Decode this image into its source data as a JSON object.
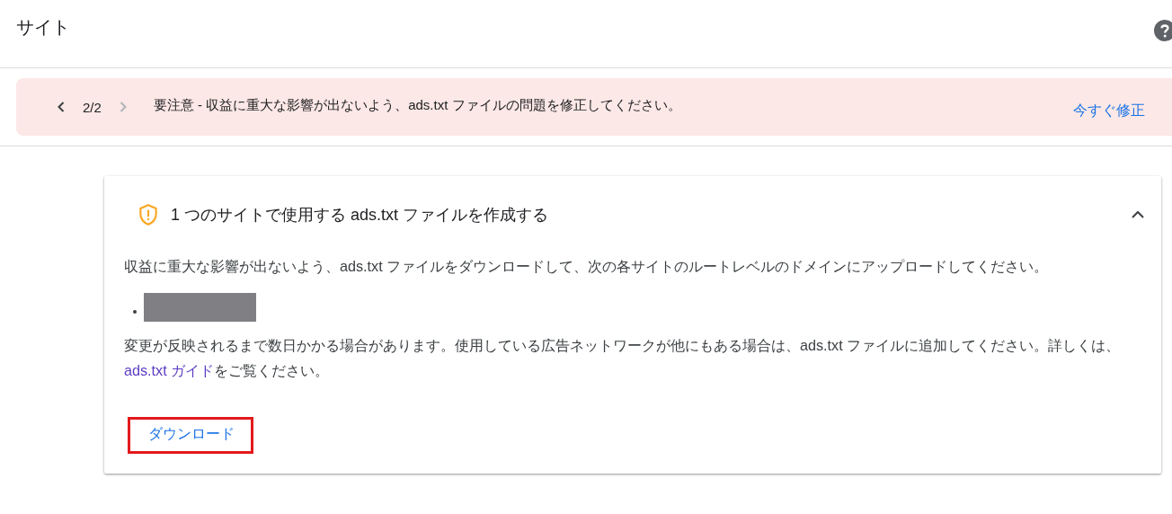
{
  "page": {
    "title": "サイト"
  },
  "alert_banner": {
    "prev": {
      "disabled": false
    },
    "counter": "2/2",
    "next": {
      "disabled": true
    },
    "message": "要注意 - 収益に重大な影響が出ないよう、ads.txt ファイルの問題を修正してください。",
    "action": "今すぐ修正"
  },
  "card": {
    "title": "1 つのサイトで使用する ads.txt ファイルを作成する",
    "expanded": true,
    "paragraph_1": "収益に重大な影響が出ないよう、ads.txt ファイルをダウンロードして、次の各サイトのルートレベルのドメインにアップロードしてください。",
    "sites": [
      {
        "kind": "redacted"
      }
    ],
    "paragraph_2": {
      "before": "変更が反映されるまで数日かかる場合があります。使用している広告ネットワークが他にもある場合は、ads.txt ファイルに追加してください。詳しくは、",
      "link": "ads.txt ガイド",
      "after": "をご覧ください。"
    },
    "button": {
      "label": "ダウンロード",
      "highlighted": true
    }
  }
}
